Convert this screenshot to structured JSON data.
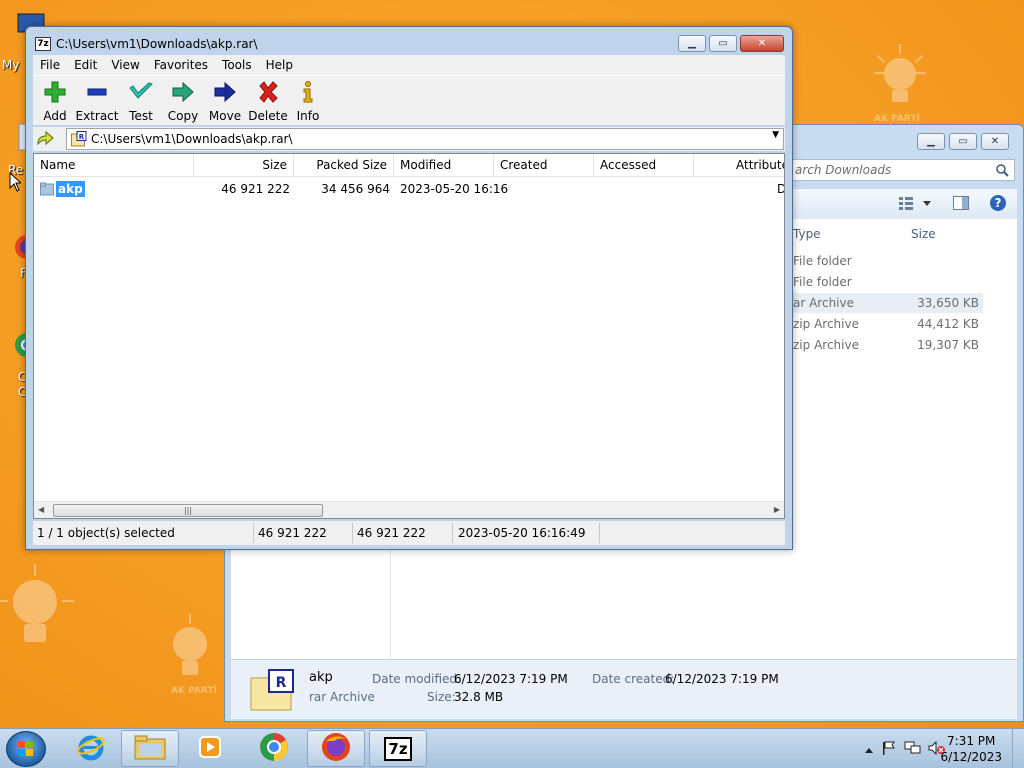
{
  "zip_window": {
    "title": "C:\\Users\\vm1\\Downloads\\akp.rar\\",
    "app_icon_text": "7z",
    "menu": [
      "File",
      "Edit",
      "View",
      "Favorites",
      "Tools",
      "Help"
    ],
    "toolbar": {
      "add": "Add",
      "extract": "Extract",
      "test": "Test",
      "copy": "Copy",
      "move": "Move",
      "delete": "Delete",
      "info": "Info"
    },
    "address": "C:\\Users\\vm1\\Downloads\\akp.rar\\",
    "columns": {
      "name": "Name",
      "size": "Size",
      "packed_size": "Packed Size",
      "modified": "Modified",
      "created": "Created",
      "accessed": "Accessed",
      "attributes": "Attribute"
    },
    "rows": [
      {
        "name": "akp",
        "size": "46 921 222",
        "packed_size": "34 456 964",
        "modified": "2023-05-20 16:16",
        "created": "",
        "accessed": "",
        "attributes": "D"
      }
    ],
    "status": {
      "selection": "1 / 1 object(s) selected",
      "size": "46 921 222",
      "packed": "46 921 222",
      "modified": "2023-05-20 16:16:49"
    }
  },
  "explorer_window": {
    "search_placeholder": "Search Downloads",
    "search_visible": "arch Downloads",
    "columns": {
      "type": "Type",
      "size": "Size"
    },
    "rows": [
      {
        "type": "File folder",
        "size": ""
      },
      {
        "type": "File folder",
        "size": ""
      },
      {
        "type": "rar Archive",
        "size": "33,650 KB",
        "selected": true
      },
      {
        "type": "zip Archive",
        "size": "44,412 KB"
      },
      {
        "type": "zip Archive",
        "size": "19,307 KB"
      }
    ],
    "visible_types": [
      "File folder",
      "File folder",
      "ar Archive",
      "zip Archive",
      "zip Archive"
    ],
    "details": {
      "name": "akp",
      "type": "rar Archive",
      "date_modified_label": "Date modified:",
      "date_modified": "6/12/2023 7:19 PM",
      "date_created_label": "Date created:",
      "date_created": "6/12/2023 7:19 PM",
      "size_label": "Size:",
      "size": "32.8 MB"
    }
  },
  "desktop": {
    "icon_labels": [
      "My",
      "Re",
      "F",
      "C",
      "C"
    ],
    "watermark_text": "AK PARTİ"
  },
  "taskbar": {
    "time": "7:31 PM",
    "date": "6/12/2023",
    "apps": [
      "internet-explorer",
      "file-explorer",
      "media-player",
      "chrome",
      "firefox",
      "7-zip"
    ],
    "active_app_label": "7z"
  },
  "colors": {
    "desktop_orange": "#f39a1e",
    "selection_blue": "#3399ff",
    "window_frame": "#bfd4ea"
  }
}
